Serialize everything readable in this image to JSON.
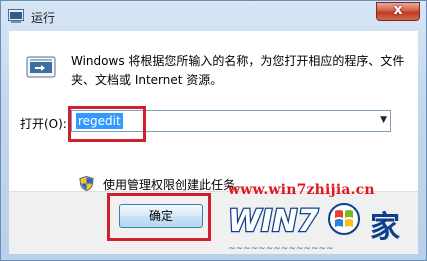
{
  "window": {
    "title": "运行",
    "close_label": "x"
  },
  "content": {
    "description": "Windows 将根据您所输入的名称，为您打开相应的程序、文件夹、文档或 Internet 资源。",
    "open_label": "打开(O):",
    "input_value": "regedit",
    "admin_note": "使用管理权限创建此任务。"
  },
  "buttons": {
    "ok_label": "确定"
  },
  "watermark": {
    "url": "www.win7zhijia.cn",
    "logo_text": "WIN7",
    "logo_suffix": "家"
  },
  "icons": {
    "app": "run-icon",
    "shield": "uac-shield-icon",
    "dropdown": "chevron-down-icon"
  },
  "colors": {
    "highlight": "#d0202f",
    "selection": "#3399ff",
    "watermark": "#e0181e"
  }
}
